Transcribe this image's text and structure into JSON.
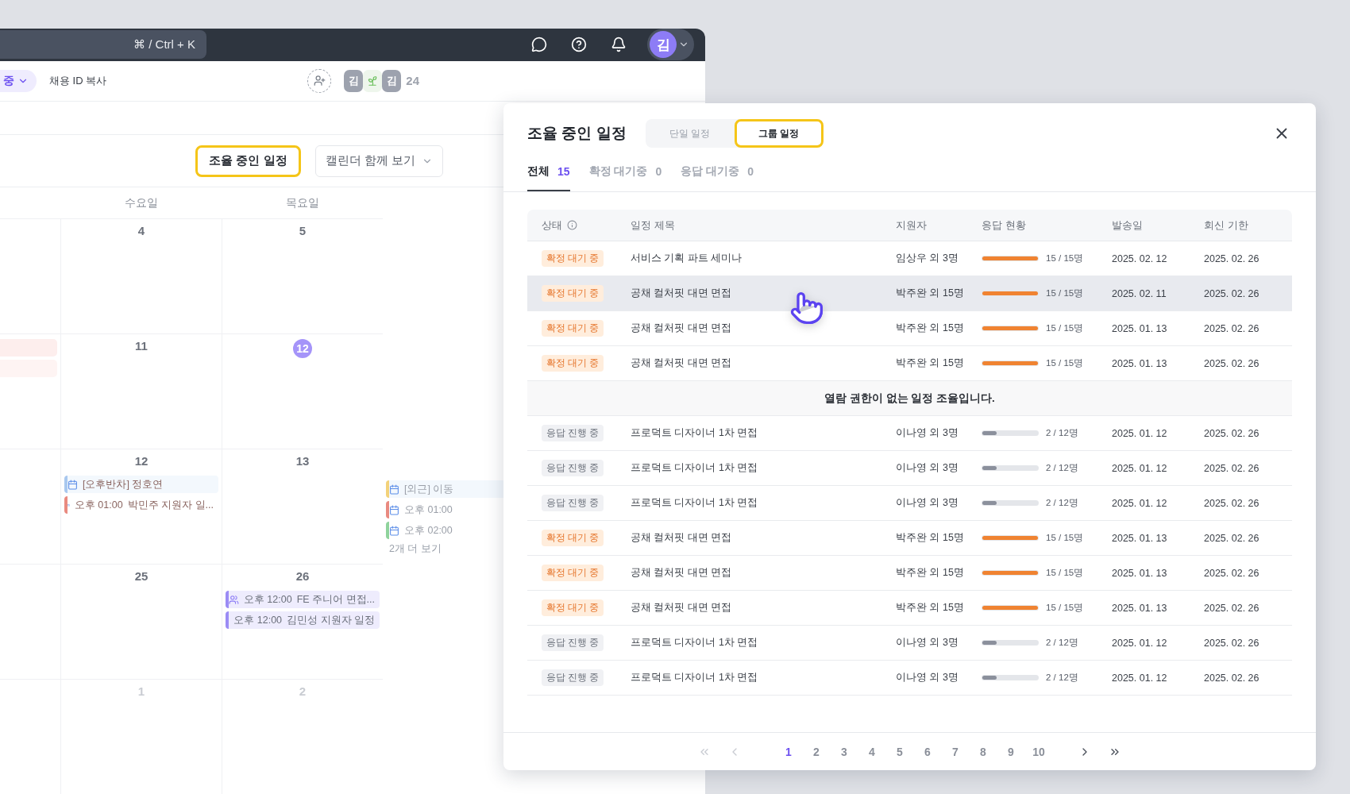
{
  "app": {
    "search_shortcut": "⌘ / Ctrl + K",
    "avatar": "김",
    "status_chip": "중",
    "copy_id": "채용 ID 복사",
    "members": [
      {
        "kind": "initial",
        "text": "김"
      },
      {
        "kind": "sprout"
      },
      {
        "kind": "initial",
        "text": "김"
      }
    ],
    "member_count": "24",
    "schedule_button": "조율 중인 일정",
    "calendar_select": "캘린더 함께 보기"
  },
  "calendar": {
    "days": [
      "수요일",
      "목요일"
    ],
    "weeks": [
      {
        "dates": [
          {
            "date": "4",
            "today": false,
            "muted": false
          },
          {
            "date": "5",
            "today": false,
            "muted": false
          }
        ]
      },
      {
        "cut_events": [
          {
            "color": "#fdeeed"
          },
          {
            "color": "#fef4f3"
          }
        ],
        "dates": [
          {
            "date": "11",
            "today": false,
            "muted": false
          },
          {
            "date": "12",
            "today": true,
            "muted": false
          }
        ]
      },
      {
        "dates": [
          {
            "date": "12",
            "today": false,
            "muted": false,
            "events": [
              {
                "kind": "google",
                "color": "#a9c8ef",
                "title": "[오후반차] 정호연"
              },
              {
                "kind": "google",
                "color": "#e98a80",
                "time": "오후 01:00",
                "title": "박민주 지원자 일..."
              }
            ]
          },
          {
            "date": "13",
            "today": false,
            "muted": false
          }
        ],
        "faded_events": [
          {
            "kind": "google",
            "color": "#f3d27a",
            "title": "[외근] 이동"
          },
          {
            "kind": "google",
            "color": "#e98a80",
            "time": "오후 01:00"
          },
          {
            "kind": "google",
            "color": "#8fd39c",
            "time": "오후 02:00"
          },
          {
            "kind": "more",
            "title": "2개 더 보기"
          }
        ]
      },
      {
        "dates": [
          {
            "date": "25",
            "today": false,
            "muted": false
          },
          {
            "date": "26",
            "today": false,
            "muted": false,
            "events": [
              {
                "kind": "group",
                "color": "#9b8cf5",
                "time": "오후 12:00",
                "title": "FE 주니어 면접..."
              },
              {
                "kind": "app",
                "color": "#9b8cf5",
                "time": "오후 12:00",
                "title": "김민성 지원자 일정"
              }
            ]
          }
        ]
      },
      {
        "dates": [
          {
            "date": "1",
            "today": false,
            "muted": true
          },
          {
            "date": "2",
            "today": false,
            "muted": true
          }
        ]
      }
    ]
  },
  "modal": {
    "title": "조율 중인 일정",
    "segments": [
      {
        "label": "단일 일정",
        "selected": false
      },
      {
        "label": "그룹 일정",
        "selected": true
      }
    ],
    "tabs": [
      {
        "label": "전체",
        "count": "15",
        "selected": true
      },
      {
        "label": "확정 대기중",
        "count": "0",
        "selected": false
      },
      {
        "label": "응답 대기중",
        "count": "0",
        "selected": false
      }
    ],
    "columns": [
      "상태",
      "일정 제목",
      "지원자",
      "응답 현황",
      "발송일",
      "회신 기한"
    ],
    "rows": [
      {
        "kind": "row",
        "status": {
          "label": "확정 대기 중",
          "kind": "confirm"
        },
        "title": "서비스 기획 파트 세미나",
        "applicant": "임상우 외 3명",
        "level": 1,
        "reading": "15 / 15명",
        "sent": "2025. 02. 12",
        "due": "2025. 02. 26",
        "hovered": false
      },
      {
        "kind": "row",
        "status": {
          "label": "확정 대기 중",
          "kind": "confirm"
        },
        "title": "공채 컬처핏 대면 면접",
        "applicant": "박주완 외 15명",
        "level": 1,
        "reading": "15 / 15명",
        "sent": "2025. 02. 11",
        "due": "2025. 02. 26",
        "hovered": true
      },
      {
        "kind": "row",
        "status": {
          "label": "확정 대기 중",
          "kind": "confirm"
        },
        "title": "공채 컬처핏 대면 면접",
        "applicant": "박주완 외 15명",
        "level": 1,
        "reading": "15 / 15명",
        "sent": "2025. 01. 13",
        "due": "2025. 02. 26",
        "hovered": false
      },
      {
        "kind": "row",
        "status": {
          "label": "확정 대기 중",
          "kind": "confirm"
        },
        "title": "공채 컬처핏 대면 면접",
        "applicant": "박주완 외 15명",
        "level": 1,
        "reading": "15 / 15명",
        "sent": "2025. 01. 13",
        "due": "2025. 02. 26",
        "hovered": false
      },
      {
        "kind": "notice",
        "text": "열람 권한이 없는 일정 조율입니다."
      },
      {
        "kind": "row",
        "status": {
          "label": "응답 진행 중",
          "kind": "progress"
        },
        "title": "프로덕트 디자이너 1차 면접",
        "applicant": "이나영 외 3명",
        "level": 0.25,
        "reading": "2 / 12명",
        "sent": "2025. 01. 12",
        "due": "2025. 02. 26",
        "hovered": false
      },
      {
        "kind": "row",
        "status": {
          "label": "응답 진행 중",
          "kind": "progress"
        },
        "title": "프로덕트 디자이너 1차 면접",
        "applicant": "이나영 외 3명",
        "level": 0.25,
        "reading": "2 / 12명",
        "sent": "2025. 01. 12",
        "due": "2025. 02. 26",
        "hovered": false
      },
      {
        "kind": "row",
        "status": {
          "label": "응답 진행 중",
          "kind": "progress"
        },
        "title": "프로덕트 디자이너 1차 면접",
        "applicant": "이나영 외 3명",
        "level": 0.25,
        "reading": "2 / 12명",
        "sent": "2025. 01. 12",
        "due": "2025. 02. 26",
        "hovered": false
      },
      {
        "kind": "row",
        "status": {
          "label": "확정 대기 중",
          "kind": "confirm"
        },
        "title": "공채 컬처핏 대면 면접",
        "applicant": "박주완 외 15명",
        "level": 1,
        "reading": "15 / 15명",
        "sent": "2025. 01. 13",
        "due": "2025. 02. 26",
        "hovered": false
      },
      {
        "kind": "row",
        "status": {
          "label": "확정 대기 중",
          "kind": "confirm"
        },
        "title": "공채 컬처핏 대면 면접",
        "applicant": "박주완 외 15명",
        "level": 1,
        "reading": "15 / 15명",
        "sent": "2025. 01. 13",
        "due": "2025. 02. 26",
        "hovered": false
      },
      {
        "kind": "row",
        "status": {
          "label": "확정 대기 중",
          "kind": "confirm"
        },
        "title": "공채 컬처핏 대면 면접",
        "applicant": "박주완 외 15명",
        "level": 1,
        "reading": "15 / 15명",
        "sent": "2025. 01. 13",
        "due": "2025. 02. 26",
        "hovered": false
      },
      {
        "kind": "row",
        "status": {
          "label": "응답 진행 중",
          "kind": "progress"
        },
        "title": "프로덕트 디자이너 1차 면접",
        "applicant": "이나영 외 3명",
        "level": 0.25,
        "reading": "2 / 12명",
        "sent": "2025. 01. 12",
        "due": "2025. 02. 26",
        "hovered": false
      },
      {
        "kind": "row",
        "status": {
          "label": "응답 진행 중",
          "kind": "progress"
        },
        "title": "프로덕트 디자이너 1차 면접",
        "applicant": "이나영 외 3명",
        "level": 0.25,
        "reading": "2 / 12명",
        "sent": "2025. 01. 12",
        "due": "2025. 02. 26",
        "hovered": false
      }
    ],
    "pagination": {
      "first": {
        "disabled": true
      },
      "prev": {
        "disabled": true
      },
      "pages": [
        {
          "label": "1",
          "selected": true
        },
        {
          "label": "2",
          "selected": false
        },
        {
          "label": "3",
          "selected": false
        },
        {
          "label": "4",
          "selected": false
        },
        {
          "label": "5",
          "selected": false
        },
        {
          "label": "6",
          "selected": false
        },
        {
          "label": "7",
          "selected": false
        },
        {
          "label": "8",
          "selected": false
        },
        {
          "label": "9",
          "selected": false
        },
        {
          "label": "10",
          "selected": false
        }
      ],
      "next": {
        "disabled": false
      },
      "last": {
        "disabled": false
      }
    }
  }
}
